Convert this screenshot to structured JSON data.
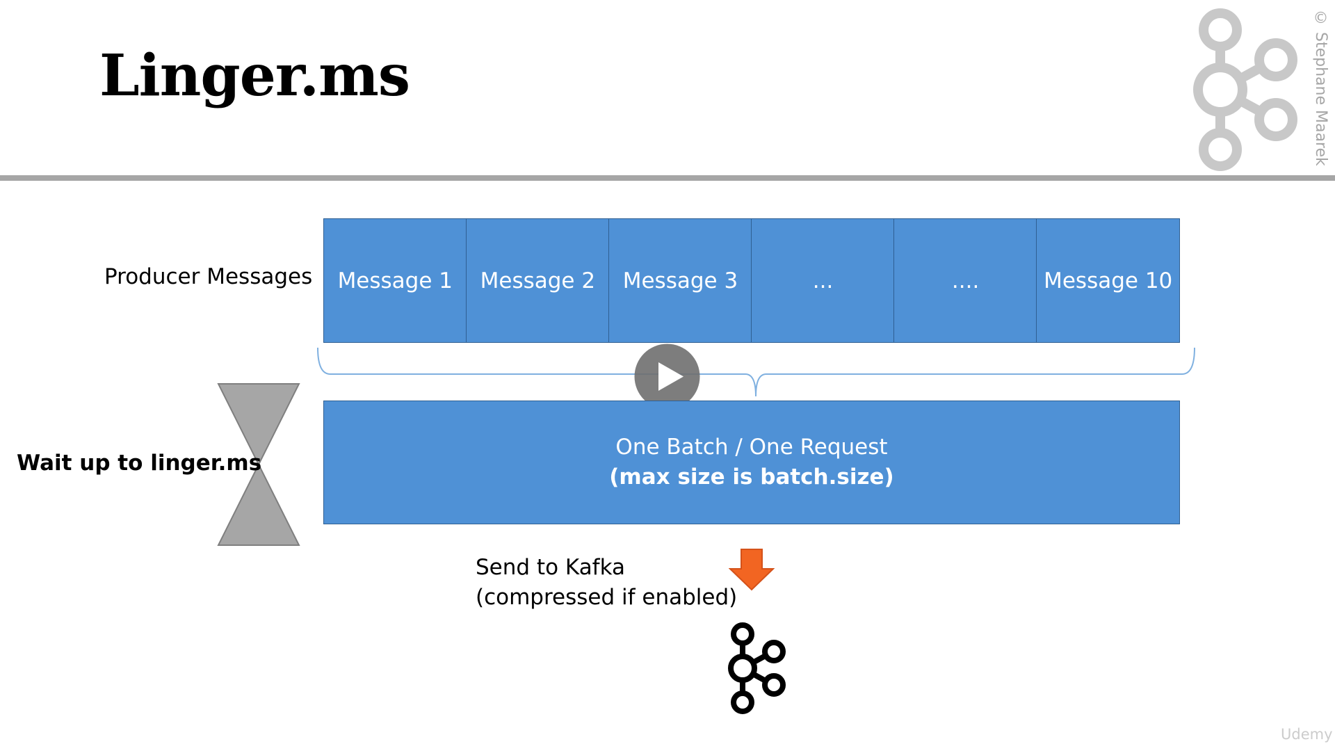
{
  "slide": {
    "title": "Linger.ms",
    "copyright": "© Stephane Maarek",
    "producer_label": "Producer Messages",
    "messages": [
      {
        "label": "Message 1"
      },
      {
        "label": "Message 2"
      },
      {
        "label": "Message 3"
      },
      {
        "label": "..."
      },
      {
        "label": "...."
      },
      {
        "label": "Message 10"
      }
    ],
    "wait_label": "Wait up to linger.ms",
    "batch": {
      "line1": "One Batch / One Request",
      "line2": "(max size is batch.size)"
    },
    "send": {
      "line1": "Send to Kafka",
      "line2": "(compressed if enabled)"
    },
    "udemy": "Udemy"
  },
  "colors": {
    "box_fill": "#4f91d6",
    "box_border": "#2f5f92",
    "header_rule": "#a6a6a6",
    "watermark": "#c8c8c8",
    "hourglass": "#a6a6a6",
    "arrow": "#f26522",
    "brace": "#7fb0e0",
    "play_button": "#6f6f6f"
  },
  "icons": {
    "watermark": "kafka-logo-icon",
    "sink": "kafka-logo-icon",
    "timer": "hourglass-icon",
    "direction": "down-arrow-icon",
    "video": "play-icon"
  }
}
